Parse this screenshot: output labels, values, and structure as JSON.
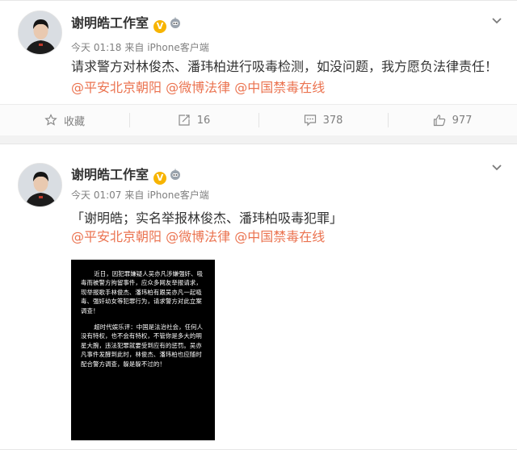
{
  "post1": {
    "author": "谢明皓工作室",
    "verified_mark": "V",
    "time": "今天 01:18",
    "source": "来自 iPhone客户端",
    "text": "请求警方对林俊杰、潘玮柏进行吸毒检测，如没问题，我方愿负法律责任！",
    "mentions": [
      "@平安北京朝阳",
      "@微博法律",
      "@中国禁毒在线"
    ],
    "actions": {
      "favorite": "收藏",
      "repost": "16",
      "comment": "378",
      "like": "977"
    }
  },
  "post2": {
    "author": "谢明皓工作室",
    "verified_mark": "V",
    "time": "今天 01:07",
    "source": "来自 iPhone客户端",
    "title": "「谢明皓；实名举报林俊杰、潘玮柏吸毒犯罪」",
    "mentions": [
      "@平安北京朝阳",
      "@微博法律",
      "@中国禁毒在线"
    ],
    "notice": {
      "paragraph1": "近日，因犯罪嫌疑人吴亦凡涉嫌强奸、吸毒而被警方拘留事件，应众多网友举报请求，现举报歌手林俊杰、潘玮柏有跟吴亦凡一起吸毒、强奸幼女等犯罪行为，请求警方对此立案调查！",
      "paragraph2": "超时代娱乐评：中国是法治社会，任何人没有特权，也不会有特权，不管你是多大的明星大腕，违法犯罪就要受到应有的惩罚。吴亦凡事件发酵到此时，林俊杰、潘玮柏也应随时配合警方调查，躲是躲不过的！"
    }
  },
  "colors": {
    "link": "#eb7350",
    "verified": "#f7b400",
    "meta": "#808080"
  }
}
